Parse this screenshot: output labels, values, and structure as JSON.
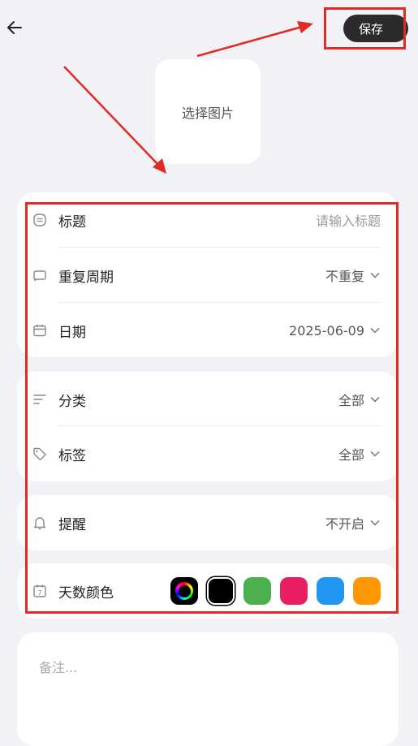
{
  "header": {
    "save_label": "保存"
  },
  "image_picker": {
    "label": "选择图片"
  },
  "basic": {
    "title_label": "标题",
    "title_placeholder": "请输入标题",
    "repeat_label": "重复周期",
    "repeat_value": "不重复",
    "date_label": "日期",
    "date_value": "2025-06-09"
  },
  "classify": {
    "category_label": "分类",
    "category_value": "全部",
    "tag_label": "标签",
    "tag_value": "全部"
  },
  "reminder": {
    "label": "提醒",
    "value": "不开启"
  },
  "day_color": {
    "label": "天数颜色",
    "colors": [
      "#000000",
      "#4caf50",
      "#e91e63",
      "#2196f3",
      "#ff9800"
    ]
  },
  "notes": {
    "placeholder": "备注..."
  },
  "annotation": {
    "color": "#e02a23"
  }
}
